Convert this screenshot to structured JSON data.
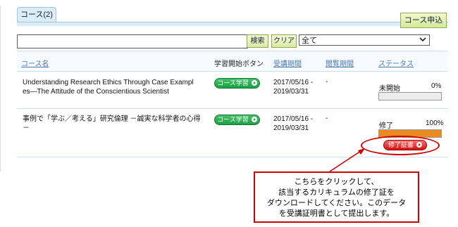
{
  "tab": {
    "label": "コース(2)"
  },
  "apply_button": "コース申込",
  "search": {
    "value": "",
    "placeholder": ""
  },
  "buttons": {
    "search": "検索",
    "clear": "クリア"
  },
  "select": {
    "value": "全て"
  },
  "headers": {
    "course_name": "コース名",
    "start_button": "学習開始ボタン",
    "period": "受講期間",
    "review_period": "閲覧期間",
    "status": "ステータス"
  },
  "rows": [
    {
      "title_line1": "Understanding Research Ethics Through Case Exampl",
      "title_line2": "es—The Attitude of the Conscientious Scientist",
      "button": "コース学習",
      "date_line1": "2017/05/16 -",
      "date_line2": "2019/03/31",
      "review": "-",
      "status_label": "未開始",
      "percent_text": "0%",
      "progress": 0
    },
    {
      "title_line1": "事例で「学ぶ／考える」研究倫理 －誠実な科学者の心得",
      "title_line2": "－",
      "button": "コース学習",
      "date_line1": "2017/05/16 -",
      "date_line2": "2019/03/31",
      "review": "-",
      "status_label": "修了",
      "percent_text": "100%",
      "progress": 1,
      "certificate_button": "修了証書"
    }
  ],
  "callout": {
    "line1": "こちらをクリックして、",
    "line2": "該当するカリキュラムの修了証を",
    "line3": "ダウンロードしてください。このデータ",
    "line4": "を受講証明書として提出します。"
  },
  "colors": {
    "accent_red": "#d00000",
    "progress": "#ec8a22",
    "green_button": "#1d9f46"
  }
}
